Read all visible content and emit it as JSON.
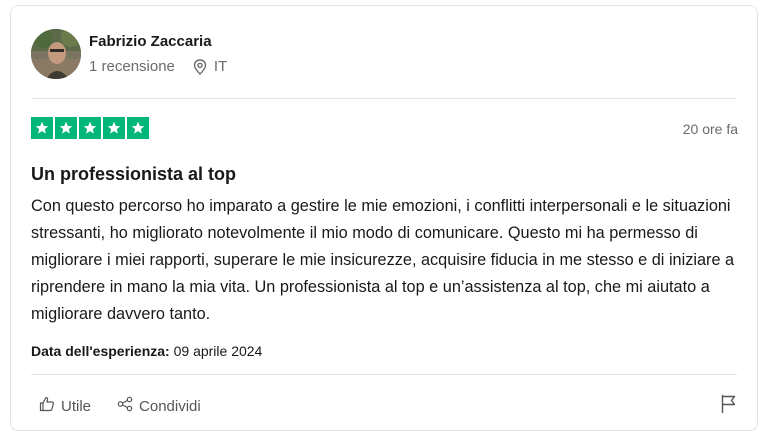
{
  "reviewer": {
    "name": "Fabrizio Zaccaria",
    "reviews_count": "1 recensione",
    "country": "IT",
    "location_icon": "map-pin-icon"
  },
  "review": {
    "rating": 5,
    "rating_max": 5,
    "star_color": "#00b67a",
    "posted": "20 ore fa",
    "title": "Un professionista al top",
    "text": "Con questo percorso ho imparato a gestire le mie emozioni, i conflitti interpersonali e le situazioni stressanti, ho migliorato notevolmente il mio modo di comunicare. Questo mi ha permesso di migliorare i miei rapporti, superare le mie insicurezze, acquisire fiducia in me stesso e di iniziare a riprendere in mano la mia vita. Un professionista al top e un’assistenza al top, che mi aiutato a migliorare davvero tanto.",
    "experience_label": "Data dell'esperienza:",
    "experience_date": "09 aprile 2024"
  },
  "actions": {
    "useful_label": "Utile",
    "useful_icon": "thumbs-up-icon",
    "share_label": "Condividi",
    "share_icon": "share-icon",
    "report_icon": "flag-icon"
  }
}
